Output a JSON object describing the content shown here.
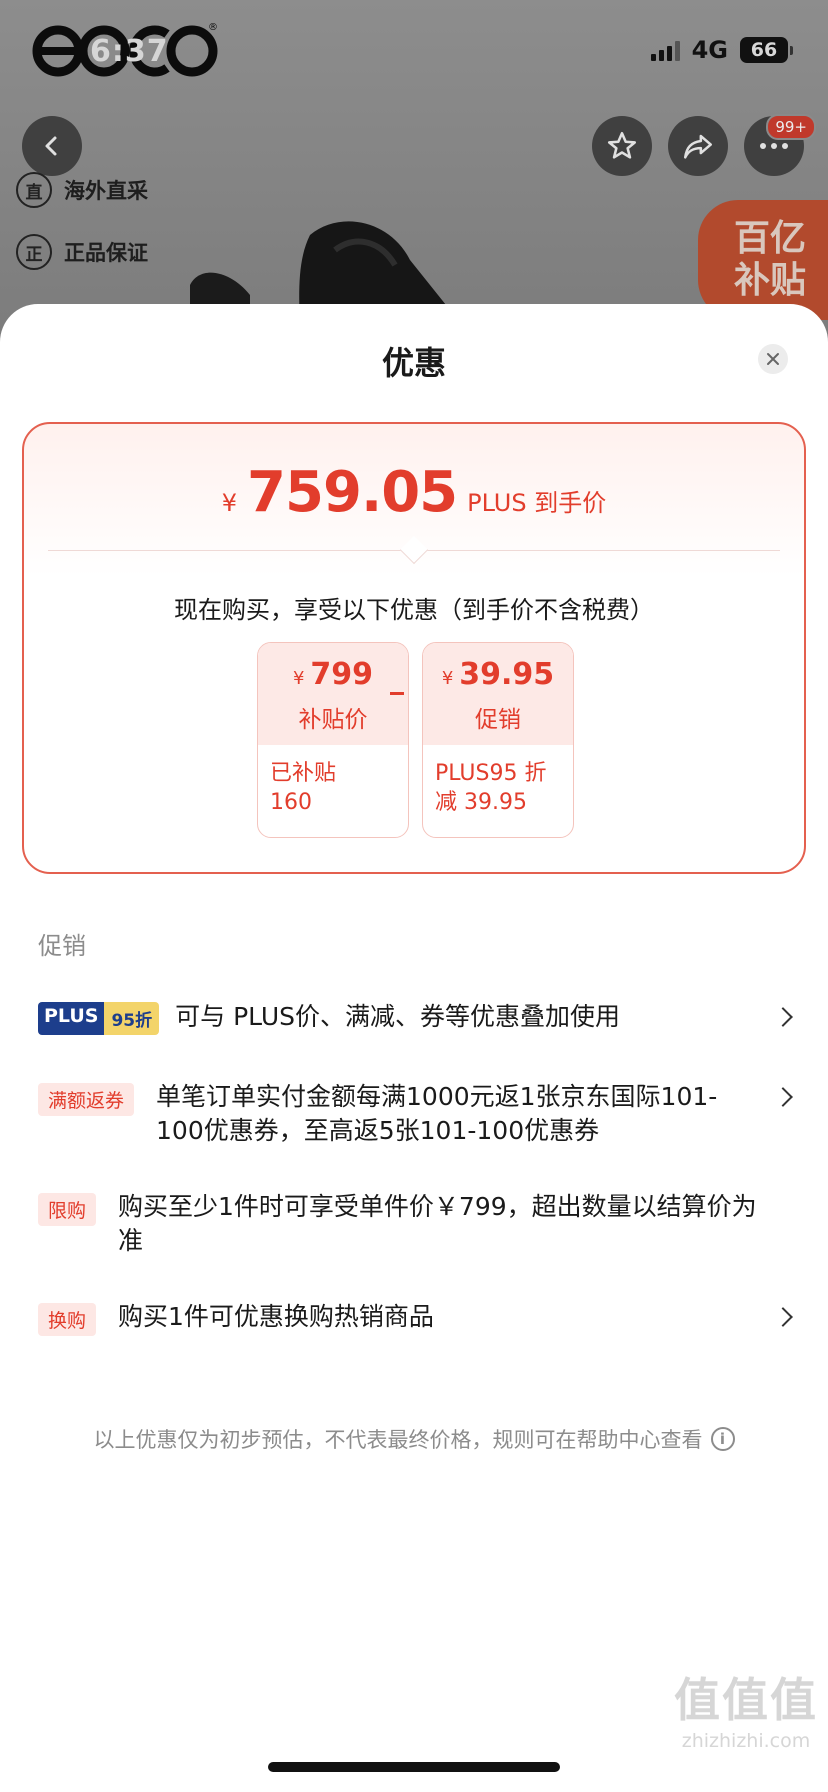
{
  "status_bar": {
    "time": "6:37",
    "network": "4G",
    "battery": "66"
  },
  "background_page": {
    "brand": "ecco",
    "badge_count": "99+",
    "features": [
      "海外直采",
      "正品保证"
    ],
    "feature_icons": [
      "直",
      "正"
    ],
    "subsidy_tag": [
      "百亿",
      "补贴"
    ]
  },
  "sheet": {
    "title": "优惠",
    "price_card": {
      "currency": "¥",
      "final_price": "759.05",
      "final_label": "PLUS 到手价",
      "note": "现在购买，享受以下优惠（到手价不含税费）",
      "items": [
        {
          "currency": "¥",
          "value": "799",
          "name": "补贴价",
          "desc_line1": "已补贴",
          "desc_line2": "160"
        },
        {
          "currency": "¥",
          "value": "39.95",
          "name": "促销",
          "desc_line1": "PLUS95 折",
          "desc_line2": "减 39.95"
        }
      ]
    },
    "promotions": {
      "heading": "促销",
      "plus_tag": {
        "left": "PLUS",
        "right": "95折"
      },
      "items": [
        {
          "text": "可与 PLUS价、满减、券等优惠叠加使用"
        },
        {
          "tag": "满额返券",
          "text": "单笔订单实付金额每满1000元返1张京东国际101-100优惠券，至高返5张101-100优惠券"
        },
        {
          "tag": "限购",
          "text": "购买至少1件时可享受单件价￥799，超出数量以结算价为准"
        },
        {
          "tag": "换购",
          "text": "购买1件可优惠换购热销商品"
        }
      ]
    },
    "disclaimer": "以上优惠仅为初步预估，不代表最终价格，规则可在帮助中心查看",
    "watermark": {
      "main": "值值值",
      "sub": "zhizhizhi.com"
    }
  },
  "colors": {
    "accent": "#e23d2c",
    "plus_blue": "#1d3e8c",
    "plus_gold": "#f3d46a"
  }
}
